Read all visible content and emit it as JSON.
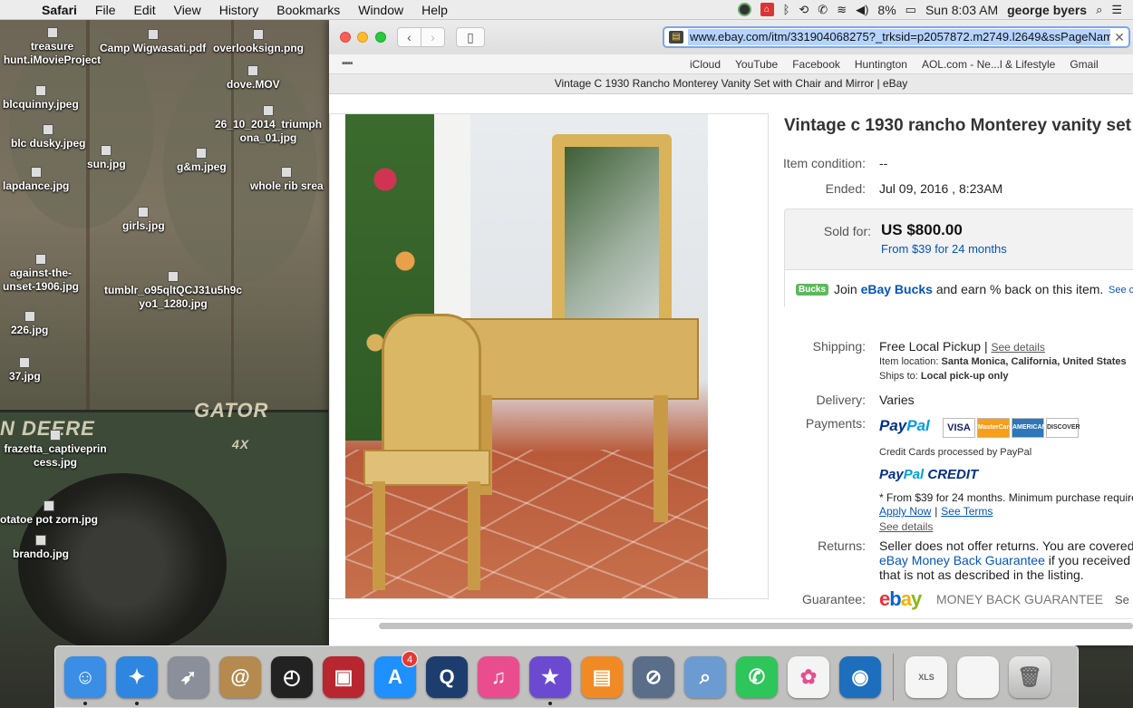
{
  "menubar": {
    "app_name": "Safari",
    "menus": [
      "File",
      "Edit",
      "View",
      "History",
      "Bookmarks",
      "Window",
      "Help"
    ],
    "battery": "8%",
    "clock": "Sun 8:03 AM",
    "user": "george byers"
  },
  "desktop": {
    "icons": [
      {
        "label": "treasure hunt.iMovieProject"
      },
      {
        "label": "Camp Wigwasati.pdf"
      },
      {
        "label": "overlooksign.png"
      },
      {
        "label": "dove.MOV"
      },
      {
        "label": "blcquinny.jpeg"
      },
      {
        "label": "26_10_2014_triumph ona_01.jpg"
      },
      {
        "label": "blc dusky.jpeg"
      },
      {
        "label": "sun.jpg"
      },
      {
        "label": "g&m.jpeg"
      },
      {
        "label": "lapdance.jpg"
      },
      {
        "label": "whole rib srea"
      },
      {
        "label": "girls.jpg"
      },
      {
        "label": "against-the- unset-1906.jpg"
      },
      {
        "label": "tumblr_o95qltQCJ31u5h9c yo1_1280.jpg"
      },
      {
        "label": "226.jpg"
      },
      {
        "label": "37.jpg"
      },
      {
        "label": "frazetta_captiveprin cess.jpg"
      },
      {
        "label": "otatoe pot zorn.jpg"
      },
      {
        "label": "brando.jpg"
      }
    ],
    "tractor_text": [
      "N DEERE",
      "GATOR",
      "4X"
    ]
  },
  "browser": {
    "url": "www.ebay.com/itm/331904068275?_trksid=p2057872.m2749.l2649&ssPageName=",
    "favorites": [
      "iCloud",
      "YouTube",
      "Facebook",
      "Huntington",
      "AOL.com - Ne...l & Lifestyle",
      "Gmail"
    ],
    "tab_title": "Vintage C 1930 Rancho Monterey Vanity Set with Chair and Mirror | eBay"
  },
  "listing": {
    "title": "Vintage c 1930 rancho Monterey vanity set",
    "condition_label": "Item condition:",
    "condition_value": "--",
    "ended_label": "Ended:",
    "ended_value": "Jul 09, 2016 , 8:23AM",
    "sold_label": "Sold for:",
    "price": "US $800.00",
    "finance": "From $39 for 24 months",
    "bucks_logo": "Bucks",
    "bucks_join": "Join",
    "bucks_link": "eBay Bucks",
    "bucks_rest": "and earn % back on this item.",
    "bucks_see": "See c",
    "shipping_label": "Shipping:",
    "shipping_value": "Free Local Pickup",
    "shipping_see": "See details",
    "location_label": "Item location:",
    "location_value": "Santa Monica, California, United States",
    "ships_label": "Ships to:",
    "ships_value": "Local pick-up only",
    "delivery_label": "Delivery:",
    "delivery_value": "Varies",
    "payments_label": "Payments:",
    "paypal_pay": "Pay",
    "paypal_pal": "Pal",
    "cards": [
      "VISA",
      "MasterCard",
      "AMERICAN EXPRESS",
      "DISCOVER"
    ],
    "cc_note": "Credit Cards processed by PayPal",
    "credit_logo": "CREDIT",
    "credit_note": "* From $39 for 24 months. Minimum purchase require",
    "apply_now": "Apply Now",
    "see_terms": "See Terms",
    "see_details2": "See details",
    "returns_label": "Returns:",
    "returns_line1": "Seller does not offer returns. You are covered",
    "returns_line2_link": "eBay Money Back Guarantee",
    "returns_line2_rest": "if you received",
    "returns_line3": "that is not as described in the listing.",
    "guarantee_label": "Guarantee:",
    "guarantee_text": "MONEY BACK GUARANTEE",
    "guarantee_see": "Se"
  },
  "dock": {
    "items": [
      {
        "name": "finder",
        "color": "#3a8ee6",
        "glyph": "☺",
        "running": true
      },
      {
        "name": "safari",
        "color": "#2f86e0",
        "glyph": "✦",
        "running": true
      },
      {
        "name": "launchpad",
        "color": "#8a8f99",
        "glyph": "➶",
        "running": false
      },
      {
        "name": "contacts",
        "color": "#b48a4e",
        "glyph": "@",
        "running": false
      },
      {
        "name": "dashboard",
        "color": "#222222",
        "glyph": "◴",
        "running": false
      },
      {
        "name": "photo-booth",
        "color": "#b8262f",
        "glyph": "▣",
        "running": false
      },
      {
        "name": "app-store",
        "color": "#1e90ff",
        "glyph": "A",
        "running": false,
        "badge": "4"
      },
      {
        "name": "quicktime",
        "color": "#1c3d6e",
        "glyph": "Q",
        "running": false
      },
      {
        "name": "itunes",
        "color": "#e94d8e",
        "glyph": "♫",
        "running": false
      },
      {
        "name": "imovie",
        "color": "#6c4ad0",
        "glyph": "★",
        "running": true
      },
      {
        "name": "ibooks",
        "color": "#f08a24",
        "glyph": "▤",
        "running": false
      },
      {
        "name": "no-entry",
        "color": "#5a6e8a",
        "glyph": "⊘",
        "running": false
      },
      {
        "name": "preview",
        "color": "#6c9bd1",
        "glyph": "⌕",
        "running": false
      },
      {
        "name": "facetime",
        "color": "#2ec55a",
        "glyph": "✆",
        "running": false
      },
      {
        "name": "photos",
        "color": "#f4f4f4",
        "glyph": "✿",
        "running": false
      },
      {
        "name": "dvd-player",
        "color": "#1d6fbd",
        "glyph": "◉",
        "running": false
      }
    ],
    "stack_items": [
      {
        "name": "xls-document",
        "label": "XLS"
      },
      {
        "name": "screenshot-stack",
        "label": ""
      },
      {
        "name": "trash",
        "label": ""
      }
    ]
  }
}
